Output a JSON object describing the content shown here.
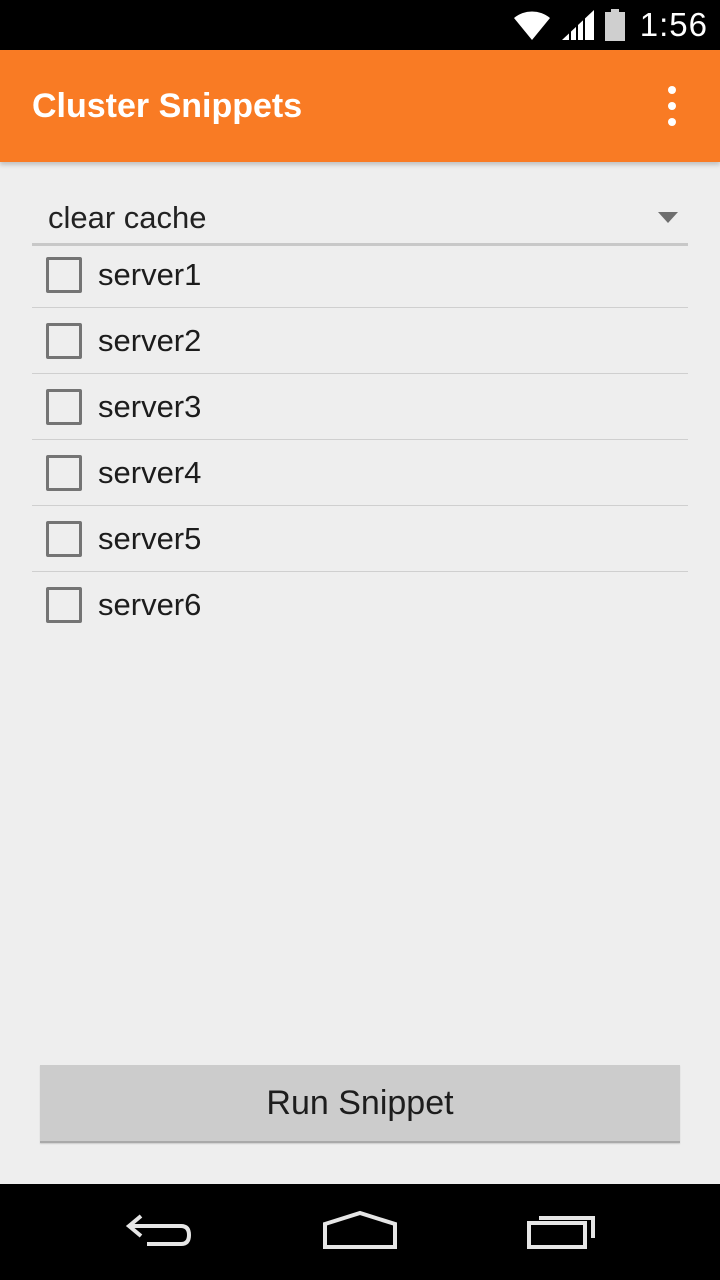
{
  "status_bar": {
    "time": "1:56",
    "icons": [
      "wifi-icon",
      "signal-icon",
      "battery-icon"
    ]
  },
  "app_bar": {
    "title": "Cluster Snippets",
    "overflow_icon": "overflow-menu-icon"
  },
  "spinner": {
    "selected": "clear cache"
  },
  "servers": [
    {
      "label": "server1",
      "checked": false
    },
    {
      "label": "server2",
      "checked": false
    },
    {
      "label": "server3",
      "checked": false
    },
    {
      "label": "server4",
      "checked": false
    },
    {
      "label": "server5",
      "checked": false
    },
    {
      "label": "server6",
      "checked": false
    }
  ],
  "run_button": {
    "label": "Run Snippet"
  },
  "nav_bar": {
    "icons": [
      "back-icon",
      "home-icon",
      "recents-icon"
    ]
  },
  "colors": {
    "accent": "#f97b24",
    "background": "#eeeeee",
    "button": "#cccccc"
  }
}
